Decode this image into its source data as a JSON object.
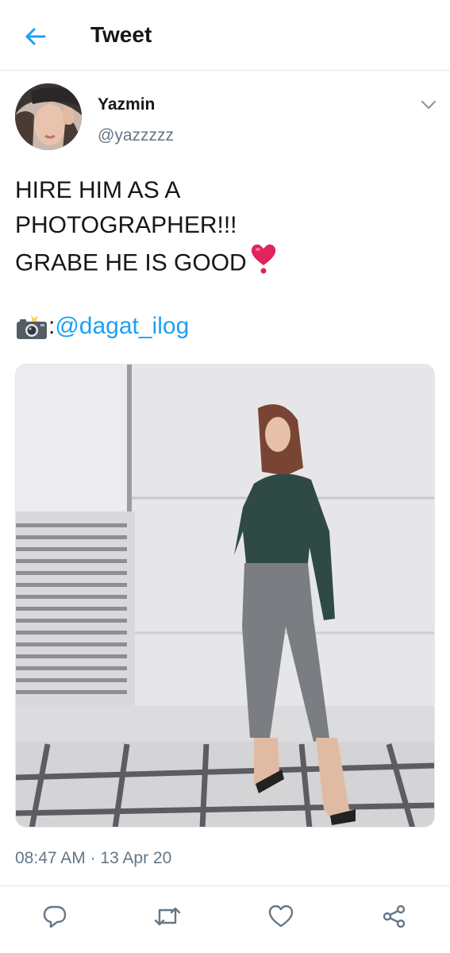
{
  "header": {
    "title": "Tweet",
    "back_icon": "arrow-left-icon",
    "accent_color": "#1da1f2"
  },
  "tweet": {
    "display_name": "Yazmin",
    "handle": "@yazzzzz",
    "text_lines": [
      "HIRE HIM AS A",
      "PHOTOGRAPHER!!!",
      "GRABE HE IS GOOD"
    ],
    "emoji_heart": "heavy-heart-exclamation-icon",
    "credit_icon": "camera-with-flash-icon",
    "credit_separator": ":",
    "mention": "@dagat_ilog",
    "timestamp": "08:47 AM · 13 Apr 20",
    "caret_icon": "chevron-down-icon"
  },
  "actions": {
    "reply_icon": "reply-icon",
    "retweet_icon": "retweet-icon",
    "like_icon": "like-icon",
    "share_icon": "share-icon"
  },
  "colors": {
    "text": "#14171a",
    "secondary": "#657786",
    "divider": "#e1e8ed",
    "heart": "#e0245e"
  }
}
